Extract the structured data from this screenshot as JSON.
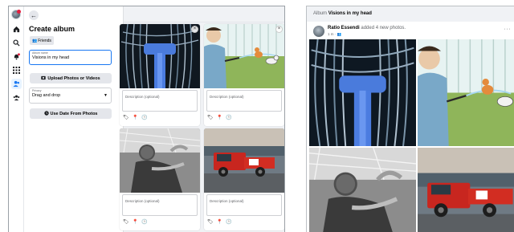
{
  "editor": {
    "title": "Create album",
    "privacy_button": "Friends",
    "album_name_label": "Album name",
    "album_name_value": "Visions in my head",
    "upload_button": "Upload Photos or Videos",
    "privacy_label": "Privacy",
    "privacy_value": "Drag and drop",
    "date_button": "Use Date From Photos",
    "cards": [
      {
        "description_placeholder": "Description (optional)",
        "image": "mop-head-photo"
      },
      {
        "description_placeholder": "Description (optional)",
        "image": "cartoon-man-hose-cat"
      },
      {
        "description_placeholder": "Description (optional)",
        "image": "bw-man-relaxing-photo"
      },
      {
        "description_placeholder": "Description (optional)",
        "image": "red-racing-truck-photo"
      }
    ]
  },
  "preview": {
    "header_prefix": "Album",
    "header_album": "Visions in my head",
    "author": "Ratio Essendi",
    "action": "added 4 new photos.",
    "meta": "1 m · 👥",
    "more": "···",
    "images": [
      "mop-head-photo",
      "cartoon-man-hose-cat",
      "bw-man-relaxing-photo",
      "red-racing-truck-photo"
    ]
  },
  "icons": {
    "rail": [
      "home-icon",
      "search-icon",
      "notifications-icon",
      "apps-icon",
      "friends-icon",
      "groups-icon"
    ],
    "card_actions": [
      "tag-icon",
      "location-icon",
      "time-icon"
    ]
  },
  "colors": {
    "accent": "#1877f2",
    "surface": "#f0f2f5",
    "button": "#e4e6eb",
    "badge": "#e41e3f"
  }
}
